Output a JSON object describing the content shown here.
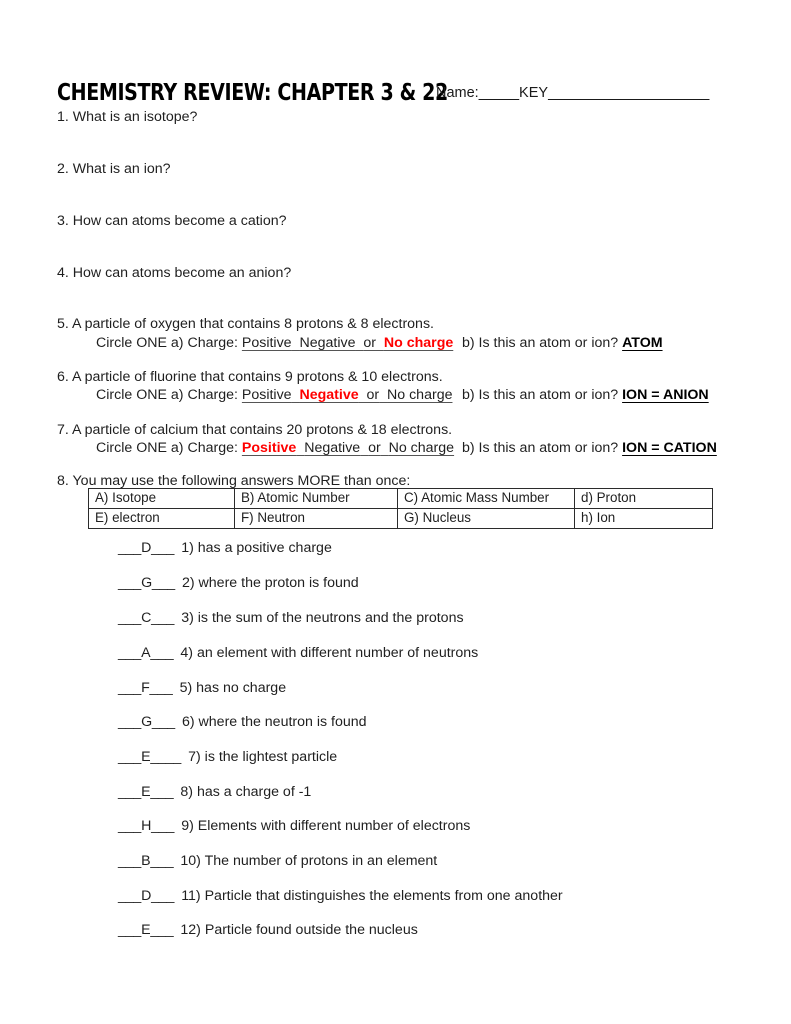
{
  "document": {
    "title": "CHEMISTRY REVIEW: CHAPTER 3 & 22",
    "name_label": "Name:",
    "name_blank_left": "_____",
    "name_value": "KEY",
    "name_blank_right": "____________________"
  },
  "questions": [
    {
      "number": "1.",
      "text": "1. What is an isotope?"
    },
    {
      "number": "2.",
      "text": "2. What is an ion?"
    },
    {
      "number": "3.",
      "text": "3. How can atoms become a cation?"
    },
    {
      "number": "4.",
      "text": "4. How can atoms become an anion?"
    }
  ],
  "charge_questions": [
    {
      "stem": "5. A particle of oxygen that contains 8 protons & 8 electrons.",
      "circle_label": "Circle ONE",
      "part_a_label": "a)  Charge:",
      "choices": [
        {
          "label": "Positive",
          "selected": false
        },
        {
          "label": "Negative",
          "selected": false
        },
        {
          "label": "or",
          "selected": false,
          "connector": true
        },
        {
          "label": "No charge",
          "selected": true
        }
      ],
      "part_b_label": "b) Is this an atom or ion?",
      "part_b_answer": "ATOM"
    },
    {
      "stem": "6. A particle of fluorine that contains 9 protons & 10 electrons.",
      "circle_label": "Circle ONE",
      "part_a_label": "a)  Charge:",
      "choices": [
        {
          "label": "Positive",
          "selected": false
        },
        {
          "label": "Negative",
          "selected": true
        },
        {
          "label": "or",
          "selected": false,
          "connector": true
        },
        {
          "label": "No charge",
          "selected": false
        }
      ],
      "part_b_label": "b) Is this an atom or ion?",
      "part_b_answer": "ION = ANION"
    },
    {
      "stem": "7. A particle of calcium that contains 20 protons & 18 electrons.",
      "circle_label": "Circle ONE",
      "part_a_label": "a)  Charge:",
      "choices": [
        {
          "label": "Positive",
          "selected": true
        },
        {
          "label": "Negative",
          "selected": false
        },
        {
          "label": "or",
          "selected": false,
          "connector": true
        },
        {
          "label": "No charge",
          "selected": false
        }
      ],
      "part_b_label": "b) Is this an atom or ion?",
      "part_b_answer": "ION = CATION"
    }
  ],
  "matching": {
    "instruction": "8. You may use the following answers MORE than once:",
    "bank_rows": [
      [
        "A) Isotope",
        "B) Atomic Number",
        "C) Atomic Mass Number",
        "d) Proton"
      ],
      [
        "E) electron",
        "F) Neutron",
        "G) Nucleus",
        "h)  Ion"
      ]
    ],
    "items": [
      {
        "blank": "___D___",
        "prompt": "1) has a positive charge"
      },
      {
        "blank": "___G___",
        "prompt": "2) where the proton is found"
      },
      {
        "blank": "___C___",
        "prompt": "3) is the sum of the neutrons and the protons"
      },
      {
        "blank": "___A___",
        "prompt": "4) an element with different number of neutrons"
      },
      {
        "blank": "___F___",
        "prompt": "5) has no charge"
      },
      {
        "blank": "___G___",
        "prompt": "6) where the neutron is found"
      },
      {
        "blank": "___E____",
        "prompt": "7) is the lightest particle"
      },
      {
        "blank": "___E___",
        "prompt": "8) has a charge of -1"
      },
      {
        "blank": "___H___",
        "prompt": "9) Elements with different number of electrons"
      },
      {
        "blank": "___B___",
        "prompt": "10) The number of protons in an element"
      },
      {
        "blank": "___D___",
        "prompt": "11) Particle that distinguishes the elements from one another"
      },
      {
        "blank": "___E___",
        "prompt": "12) Particle found outside the nucleus"
      }
    ]
  },
  "colors": {
    "answer_red": "#ff0000",
    "text": "#1f1f1f",
    "table_border": "#2b2b2b"
  }
}
